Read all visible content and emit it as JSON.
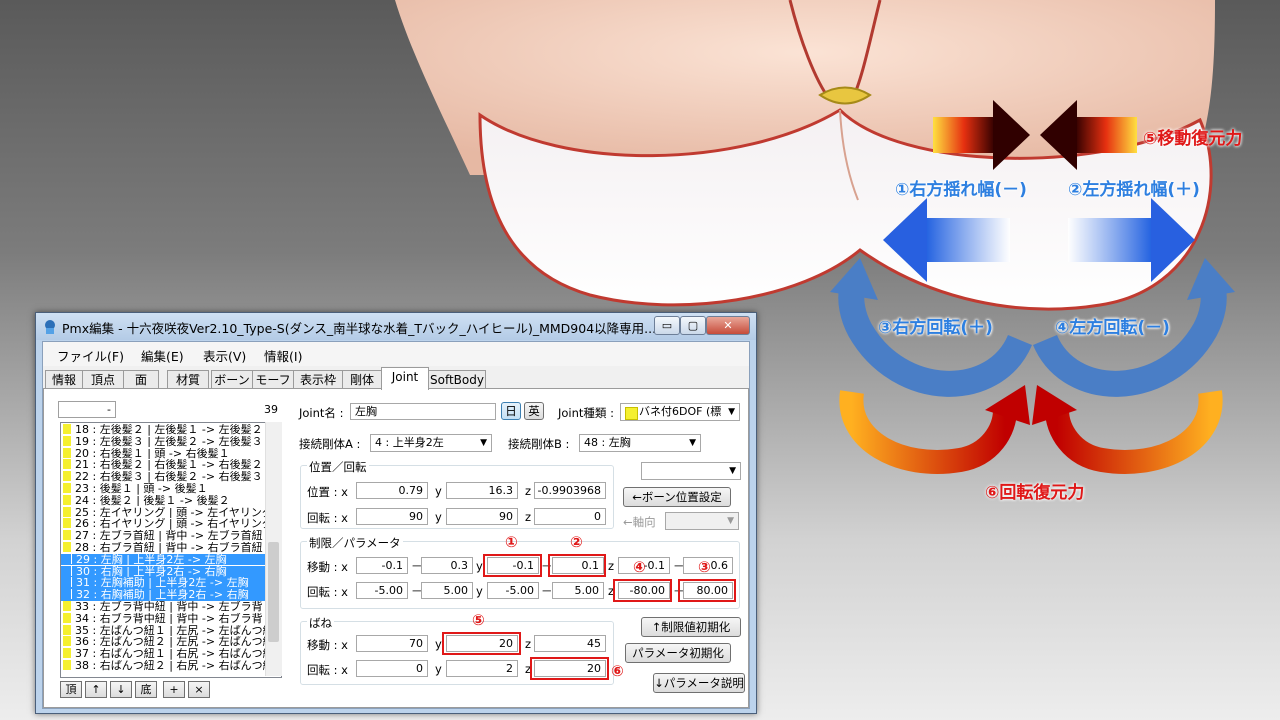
{
  "annotations": {
    "restore_move": "⑤移動復元力",
    "right_sway": "①右方揺れ幅(－)",
    "left_sway": "②左方揺れ幅(＋)",
    "right_rot": "③右方回転(＋)",
    "left_rot": "④左方回転(－)",
    "restore_rot": "⑥回転復元力"
  },
  "colors": {
    "blue": "#2d7fe0",
    "red": "#e01818",
    "list_highlight": "#3399ff",
    "marker_yellow": "#f5f030"
  },
  "window": {
    "title": "Pmx編集 - 十六夜咲夜Ver2.10_Type-S(ダンス_南半球な水着_Tバック_ハイヒール)_MMD904以降専用....",
    "min": "▭",
    "max": "▢",
    "close": "✕"
  },
  "menu": [
    "ファイル(F)",
    "編集(E)",
    "表示(V)",
    "情報(I)"
  ],
  "tabs": [
    "情報",
    "頂点",
    "面",
    "材質",
    "ボーン",
    "モーフ",
    "表示枠",
    "剛体",
    "Joint",
    "SoftBody"
  ],
  "active_tab": "Joint",
  "list": {
    "counter": "-",
    "count": "39",
    "items": [
      {
        "text": "18 : 左後髪２ | 左後髪１ -> 左後髪２",
        "sel": false
      },
      {
        "text": "19 : 左後髪３ | 左後髪２ -> 左後髪３",
        "sel": false
      },
      {
        "text": "20 : 右後髪１ | 頭 -> 右後髪１",
        "sel": false
      },
      {
        "text": "21 : 右後髪２ | 右後髪１ -> 右後髪２",
        "sel": false
      },
      {
        "text": "22 : 右後髪３ | 右後髪２ -> 右後髪３",
        "sel": false
      },
      {
        "text": "23 : 後髪１ | 頭 -> 後髪１",
        "sel": false
      },
      {
        "text": "24 : 後髪２ | 後髪１ -> 後髪２",
        "sel": false
      },
      {
        "text": "25 : 左イヤリング | 頭 -> 左イヤリング",
        "sel": false
      },
      {
        "text": "26 : 右イヤリング | 頭 -> 右イヤリング",
        "sel": false
      },
      {
        "text": "27 : 左ブラ首紐 | 背中 -> 左ブラ首紐",
        "sel": false
      },
      {
        "text": "28 : 右ブラ首紐 | 背中 -> 右ブラ首紐",
        "sel": false
      },
      {
        "text": "29 : 左胸 | 上半身2左 -> 左胸",
        "sel": true
      },
      {
        "text": "30 : 右胸 | 上半身2右 -> 右胸",
        "sel": true
      },
      {
        "text": "31 : 左胸補助 | 上半身2左 -> 左胸",
        "sel": true
      },
      {
        "text": "32 : 右胸補助 | 上半身2右 -> 右胸",
        "sel": true
      },
      {
        "text": "33 : 左ブラ背中紐 | 背中 -> 左ブラ背",
        "sel": false
      },
      {
        "text": "34 : 右ブラ背中紐 | 背中 -> 右ブラ背",
        "sel": false
      },
      {
        "text": "35 : 左ぱんつ紐１ | 左尻 -> 左ぱんつ紐",
        "sel": false
      },
      {
        "text": "36 : 左ぱんつ紐２ | 左尻 -> 左ぱんつ紐",
        "sel": false
      },
      {
        "text": "37 : 右ぱんつ紐１ | 右尻 -> 右ぱんつ紐",
        "sel": false
      },
      {
        "text": "38 : 右ぱんつ紐２ | 右尻 -> 右ぱんつ紐",
        "sel": false
      }
    ],
    "nav": [
      "頂",
      "↑",
      "↓",
      "底",
      "+",
      "×"
    ]
  },
  "joint": {
    "name_label": "Joint名 :",
    "name": "左胸",
    "jp_btn": "日",
    "en_btn": "英",
    "type_label": "Joint種類 :",
    "type": "バネ付6DOF (標",
    "bodyA_label": "接続剛体A :",
    "bodyA": "4 : 上半身2左",
    "bodyB_label": "接続剛体B :",
    "bodyB": "48 : 左胸",
    "pos_group": "位置／回転",
    "pos_label": "位置 : x",
    "rot_label": "回転 : x",
    "y": "y",
    "z": "z",
    "pos": [
      "0.79",
      "16.3",
      "-0.9903968"
    ],
    "rot": [
      "90",
      "90",
      "0"
    ],
    "bone_pos_btn": "←ボーン位置設定",
    "axis_label": "←軸向",
    "limit_group": "制限／パラメータ",
    "move_label": "移動 : x",
    "limit_move": [
      "-0.1",
      "0.3",
      "-0.1",
      "0.1",
      "-0.1",
      "0.6"
    ],
    "limit_rot": [
      "-5.00",
      "5.00",
      "-5.00",
      "5.00",
      "-80.00",
      "80.00"
    ],
    "limit_reset_btn": "↑制限値初期化",
    "spring_group": "ばね",
    "spring_move": [
      "70",
      "20",
      "45"
    ],
    "spring_rot": [
      "0",
      "2",
      "20"
    ],
    "param_reset_btn": "パラメータ初期化",
    "param_help_btn": "↓パラメータ説明",
    "marks": [
      "①",
      "②",
      "③",
      "④",
      "⑤",
      "⑥"
    ],
    "dash": "－"
  }
}
